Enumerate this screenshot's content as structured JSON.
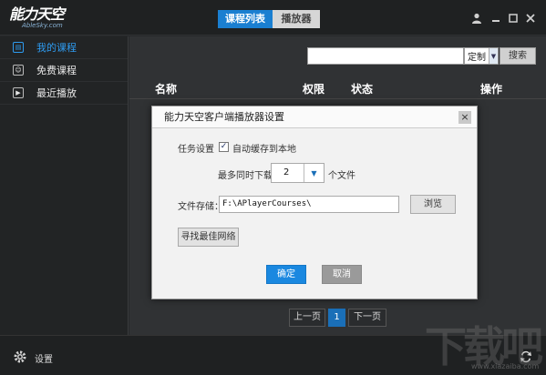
{
  "app": {
    "logo_text": "能力天空",
    "logo_sub": "AbleSky.com"
  },
  "topnav": {
    "tabs": [
      {
        "label": "课程列表",
        "active": true
      },
      {
        "label": "播放器",
        "active": false
      }
    ]
  },
  "window": {
    "user_icon": "user-icon",
    "minimize_icon": "minimize-icon",
    "maximize_icon": "maximize-icon",
    "close_icon": "close-icon"
  },
  "sidebar": {
    "items": [
      {
        "label": "我的课程",
        "icon": "my-courses-icon",
        "active": true
      },
      {
        "label": "免费课程",
        "icon": "free-courses-icon",
        "active": false
      },
      {
        "label": "最近播放",
        "icon": "recent-play-icon",
        "active": false
      }
    ]
  },
  "search": {
    "value": "",
    "dropdown_value": "定制",
    "button_label": "搜索"
  },
  "table": {
    "headers": [
      "名称",
      "权限",
      "状态",
      "操作"
    ]
  },
  "pager": {
    "prev_label": "上一页",
    "current_page": "1",
    "next_label": "下一页"
  },
  "bottom": {
    "settings_label": "设置"
  },
  "dialog": {
    "title": "能力天空客户端播放器设置",
    "task_label": "任务设置",
    "auto_cache_label": "自动缓存到本地",
    "auto_cache_checked": true,
    "max_download_label": "最多同时下载",
    "max_download_value": "2",
    "files_unit": "个文件",
    "storage_label": "文件存储：",
    "storage_path": "F:\\APlayerCourses\\",
    "browse_label": "浏览",
    "find_network_label": "寻找最佳网络",
    "ok_label": "确定",
    "cancel_label": "取消"
  },
  "watermark": {
    "text": "下载吧",
    "sub": "www.xiazaiba.com"
  },
  "colors": {
    "accent": "#1a88e0",
    "dark_bg": "#26282a",
    "active_sidebar": "#2e9bf0"
  }
}
